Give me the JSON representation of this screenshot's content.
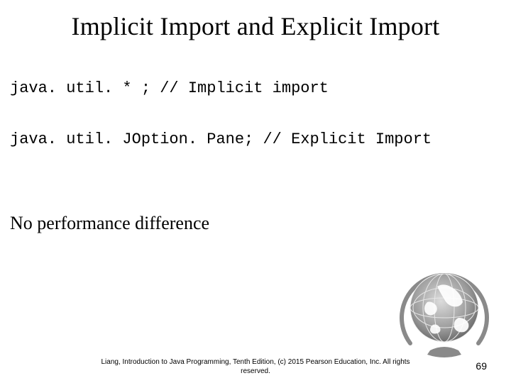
{
  "title": "Implicit Import and Explicit Import",
  "code": {
    "line1": "java. util. * ; // Implicit import",
    "line2": "java. util. JOption. Pane; // Explicit Import"
  },
  "body": "No performance difference",
  "footer": "Liang, Introduction to Java Programming, Tenth Edition, (c) 2015 Pearson Education, Inc. All rights reserved.",
  "page_number": "69",
  "icons": {
    "globe": "globe-icon"
  }
}
